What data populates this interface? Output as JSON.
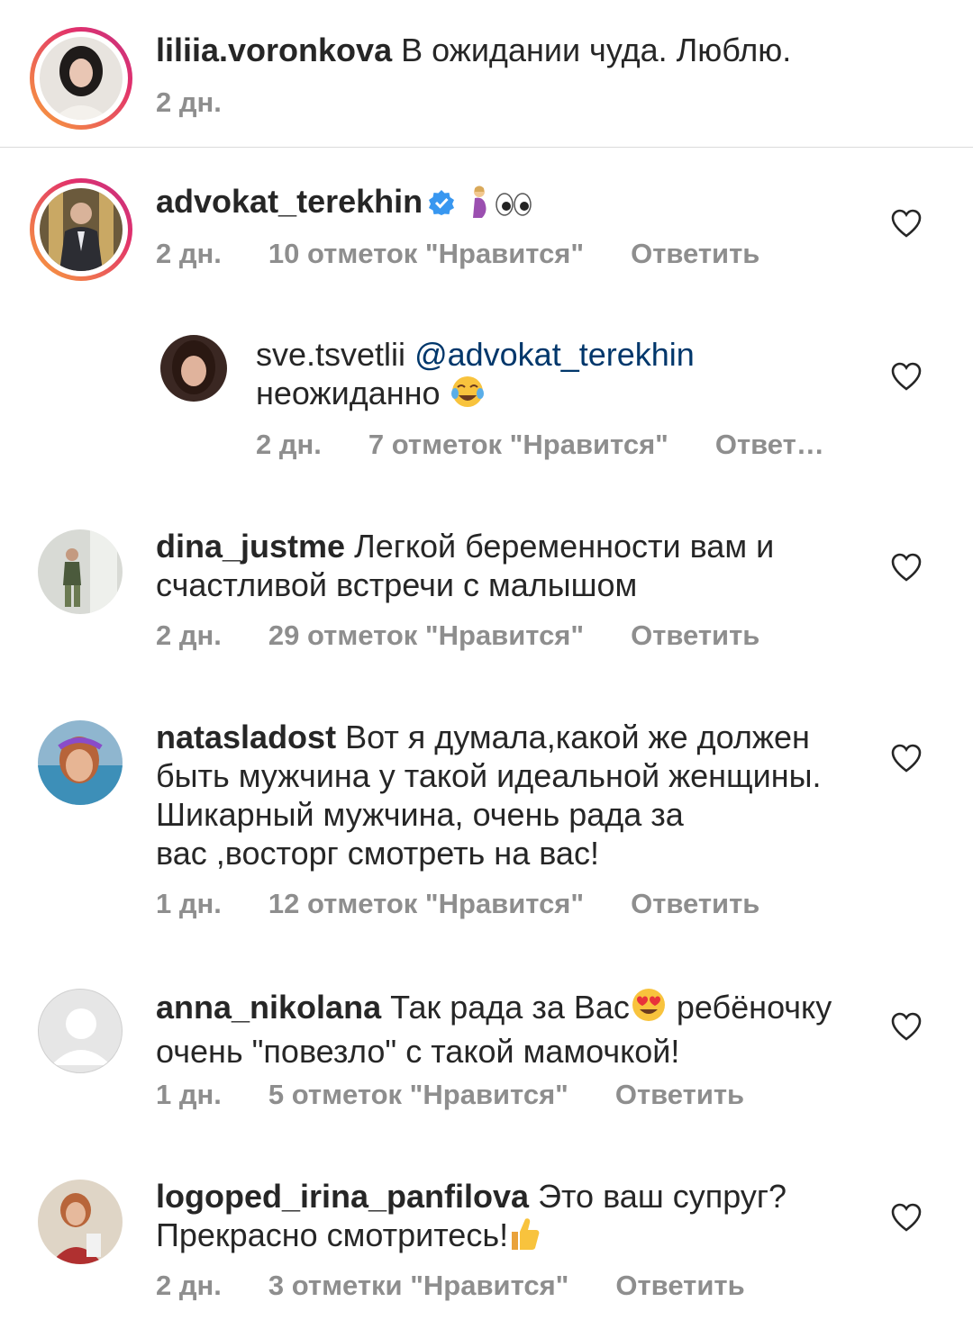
{
  "caption": {
    "username": "liliia.voronkova",
    "text": "В ожидании чуда. Люблю.",
    "time": "2 дн."
  },
  "comments": [
    {
      "username": "advokat_terekhin",
      "text": "",
      "emojis": [
        "pregnant-woman-emoji",
        "eyes-emoji"
      ],
      "verified": true,
      "time": "2 дн.",
      "likes": "10 отметок \"Нравится\"",
      "reply": "Ответить",
      "replies": [
        {
          "username": "sve.tsvetlii",
          "mention": "@advokat_terekhin",
          "text": "неожиданно",
          "emoji": "tears-of-joy-emoji",
          "time": "2 дн.",
          "likes": "7 отметок \"Нравится\"",
          "reply": "Ответ…"
        }
      ]
    },
    {
      "username": "dina_justme",
      "text_line1": "Легкой беременности вам и",
      "text_line2": "счастливой встречи с малышом",
      "time": "2 дн.",
      "likes": "29 отметок \"Нравится\"",
      "reply": "Ответить"
    },
    {
      "username": "natasladost",
      "text_line1": "Вот я думала,какой же должен",
      "text_line2": "быть мужчина у такой идеальной женщины.",
      "text_line3": "Шикарный мужчина, очень рада за",
      "text_line4": "вас ,восторг смотреть на вас!",
      "time": "1 дн.",
      "likes": "12 отметок \"Нравится\"",
      "reply": "Ответить"
    },
    {
      "username": "anna_nikolana",
      "text_line1a": "Так рада за Вас",
      "emoji": "heart-eyes-emoji",
      "text_line1b": "ребёночку",
      "text_line2": "очень \"повезло\" с такой мамочкой!",
      "time": "1 дн.",
      "likes": "5 отметок \"Нравится\"",
      "reply": "Ответить"
    },
    {
      "username": "logoped_irina_panfilova",
      "text_line1": "Это ваш супруг?",
      "text_line2": "Прекрасно смотритесь!",
      "emoji": "thumbs-up-emoji",
      "time": "2 дн.",
      "likes": "3 отметки \"Нравится\"",
      "reply": "Ответить"
    }
  ],
  "icons": {
    "like": "heart-outline-icon",
    "verified": "verified-badge-icon"
  },
  "colors": {
    "text": "#262626",
    "meta": "#8e8e8e",
    "mention": "#00376b",
    "verified": "#3897f0"
  }
}
